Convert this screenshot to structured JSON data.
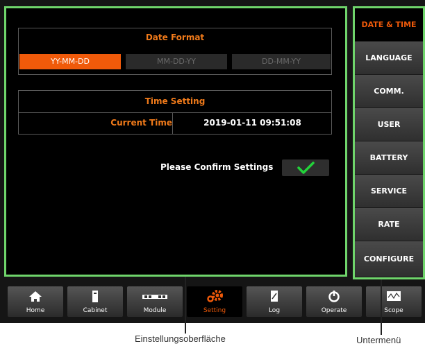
{
  "colors": {
    "accent": "#f05a0a",
    "frame": "#6fd56b",
    "check": "#22d33a"
  },
  "date_format": {
    "title": "Date Format",
    "options": [
      "YY-MM-DD",
      "MM-DD-YY",
      "DD-MM-YY"
    ],
    "selected": "YY-MM-DD"
  },
  "time_setting": {
    "title": "Time Setting",
    "label": "Current Time",
    "value": "2019-01-11   09:51:08"
  },
  "confirm": {
    "label": "Please Confirm Settings",
    "icon": "checkmark-icon"
  },
  "sidebar": {
    "items": [
      {
        "label": "DATE & TIME",
        "active": true
      },
      {
        "label": "LANGUAGE"
      },
      {
        "label": "COMM."
      },
      {
        "label": "USER"
      },
      {
        "label": "BATTERY"
      },
      {
        "label": "SERVICE"
      },
      {
        "label": "RATE"
      },
      {
        "label": "CONFIGURE"
      }
    ]
  },
  "nav": {
    "items": [
      {
        "label": "Home",
        "icon": "home-icon"
      },
      {
        "label": "Cabinet",
        "icon": "cabinet-icon"
      },
      {
        "label": "Module",
        "icon": "module-icon"
      },
      {
        "label": "Setting",
        "icon": "gear-icon",
        "active": true
      },
      {
        "label": "Log",
        "icon": "log-icon"
      },
      {
        "label": "Operate",
        "icon": "power-icon"
      },
      {
        "label": "Scope",
        "icon": "scope-icon"
      }
    ]
  },
  "callouts": {
    "settings_screen": "Einstellungsoberfläche",
    "submenu": "Untermenü"
  }
}
